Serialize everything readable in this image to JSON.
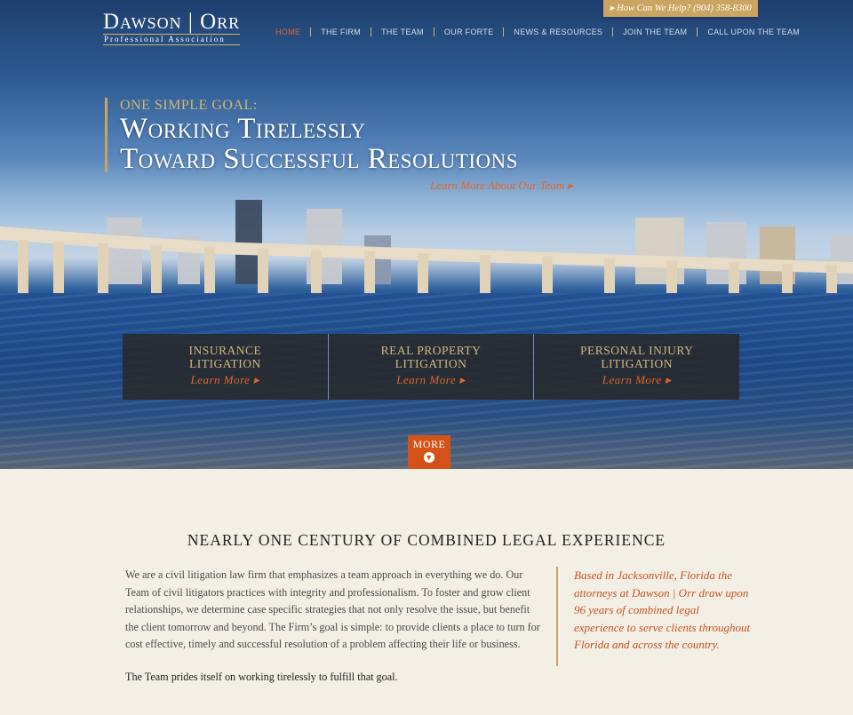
{
  "brand": {
    "name": "Dawson | Orr",
    "sub": "Professional Association"
  },
  "help_button": "How Can We Help? (904) 358-8300",
  "nav": [
    "HOME",
    "THE FIRM",
    "THE TEAM",
    "OUR FORTE",
    "NEWS & RESOURCES",
    "JOIN THE TEAM",
    "CALL UPON THE TEAM"
  ],
  "hero": {
    "kicker": "ONE SIMPLE GOAL:",
    "headline_1": "Working Tirelessly",
    "headline_2": "Toward Successful Resolutions",
    "learn_more": "Learn More About Our Team"
  },
  "practices": [
    {
      "line1": "INSURANCE",
      "line2": "LITIGATION",
      "link": "Learn More"
    },
    {
      "line1": "REAL PROPERTY",
      "line2": "LITIGATION",
      "link": "Learn More"
    },
    {
      "line1": "PERSONAL INJURY",
      "line2": "LITIGATION",
      "link": "Learn More"
    }
  ],
  "more_button": "MORE",
  "content": {
    "heading": "NEARLY ONE CENTURY OF COMBINED LEGAL EXPERIENCE",
    "paragraph": "We are a civil litigation law firm that emphasizes a team approach in everything we do. Our Team of civil litigators practices with integrity and professionalism. To foster and grow client relationships, we determine case specific strategies that not only resolve the issue, but benefit the client tomorrow and beyond. The Firm’s goal is simple: to provide clients a place to turn for cost effective, timely and successful resolution of a problem affecting their life or business.",
    "closing": "The Team prides itself on working tirelessly to fulfill that goal.",
    "quote": "Based in Jacksonville, Florida the attorneys at Dawson | Orr draw upon 96 years of combined legal experience to serve clients throughout Florida and across the country."
  },
  "colors": {
    "accent_orange": "#e0662d",
    "gold": "#c9a560",
    "background": "#f4efe5"
  }
}
